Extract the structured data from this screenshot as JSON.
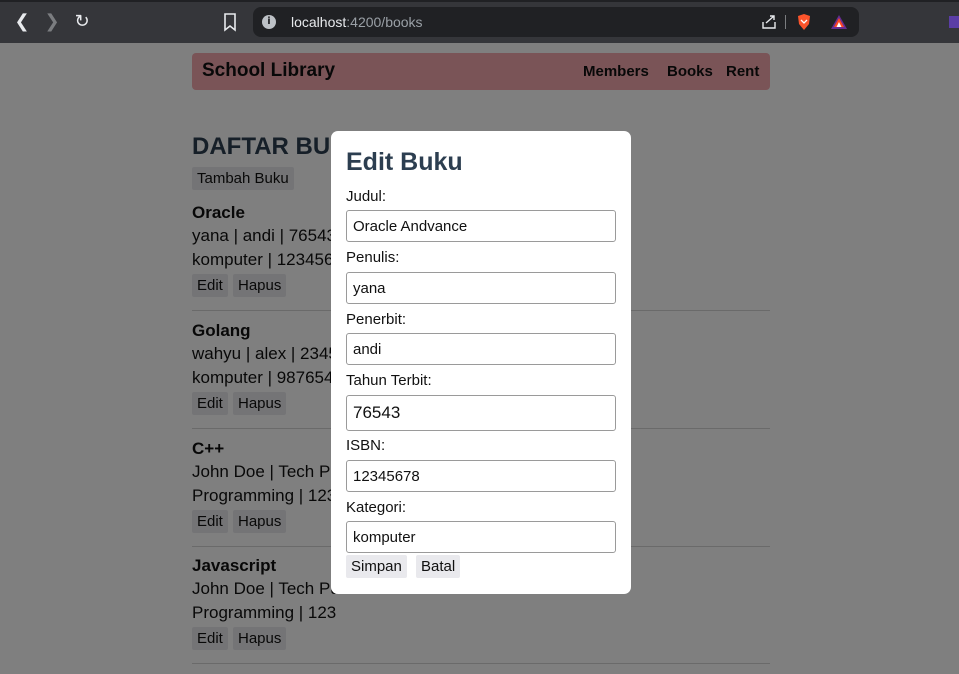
{
  "browser": {
    "url_host": "localhost",
    "url_rest": ":4200/books"
  },
  "navbar": {
    "brand": "School Library",
    "links": [
      "Members",
      "Books",
      "Rent"
    ]
  },
  "list": {
    "title": "DAFTAR BUKU",
    "add_button": "Tambah Buku",
    "edit_button": "Edit",
    "delete_button": "Hapus",
    "books": [
      {
        "title": "Oracle",
        "line1": "yana | andi | 76543",
        "line2": "komputer | 12345678"
      },
      {
        "title": "Golang",
        "line1": "wahyu | alex | 23456",
        "line2": "komputer | 98765432"
      },
      {
        "title": "C++",
        "line1": "John Doe | Tech Publisher",
        "line2": "Programming | 123"
      },
      {
        "title": "Javascript",
        "line1": "John Doe | Tech Publisher",
        "line2": "Programming | 123"
      }
    ]
  },
  "modal": {
    "title": "Edit Buku",
    "fields": [
      {
        "label": "Judul:",
        "value": "Oracle Andvance"
      },
      {
        "label": "Penulis:",
        "value": "yana"
      },
      {
        "label": "Penerbit:",
        "value": "andi"
      },
      {
        "label": "Tahun Terbit:",
        "value": "76543"
      },
      {
        "label": "ISBN:",
        "value": "12345678"
      },
      {
        "label": "Kategori:",
        "value": "komputer"
      }
    ],
    "save_button": "Simpan",
    "cancel_button": "Batal"
  }
}
